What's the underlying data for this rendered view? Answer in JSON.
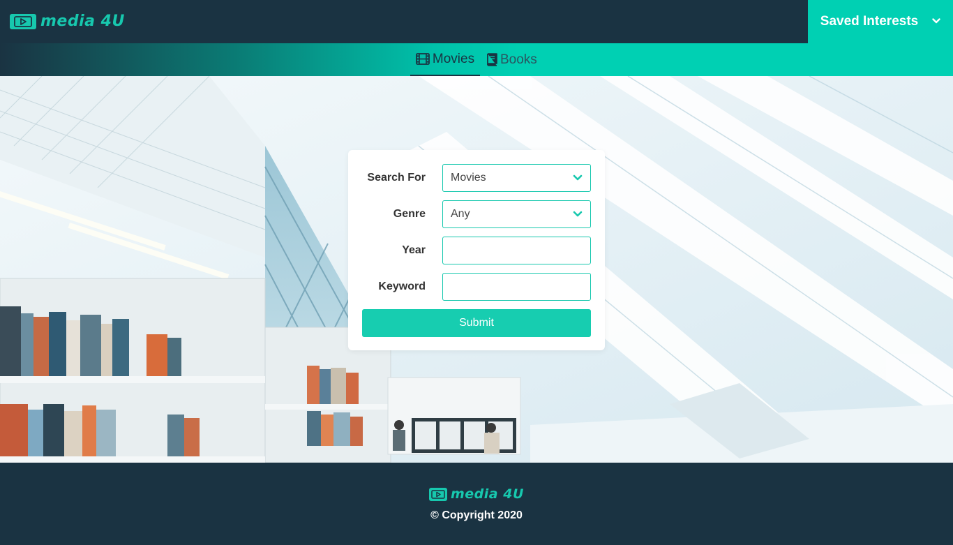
{
  "brand": {
    "name": "media 4U",
    "accent": "#17c8ae",
    "dark": "#1a3342",
    "teal": "#00d0b3"
  },
  "header": {
    "saved_interests_label": "Saved Interests",
    "saved_interests_icon": "chevron-down-icon"
  },
  "nav": {
    "tabs": [
      {
        "label": "Movies",
        "icon": "film-icon",
        "active": true
      },
      {
        "label": "Books",
        "icon": "book-icon",
        "active": false
      }
    ]
  },
  "hero": {
    "background": "library-interior-photo"
  },
  "search_form": {
    "fields": [
      {
        "label": "Search For",
        "type": "select",
        "value": "Movies"
      },
      {
        "label": "Genre",
        "type": "select",
        "value": "Any"
      },
      {
        "label": "Year",
        "type": "text",
        "value": ""
      },
      {
        "label": "Keyword",
        "type": "text",
        "value": ""
      }
    ],
    "submit_label": "Submit"
  },
  "footer": {
    "copyright": "© Copyright 2020"
  }
}
